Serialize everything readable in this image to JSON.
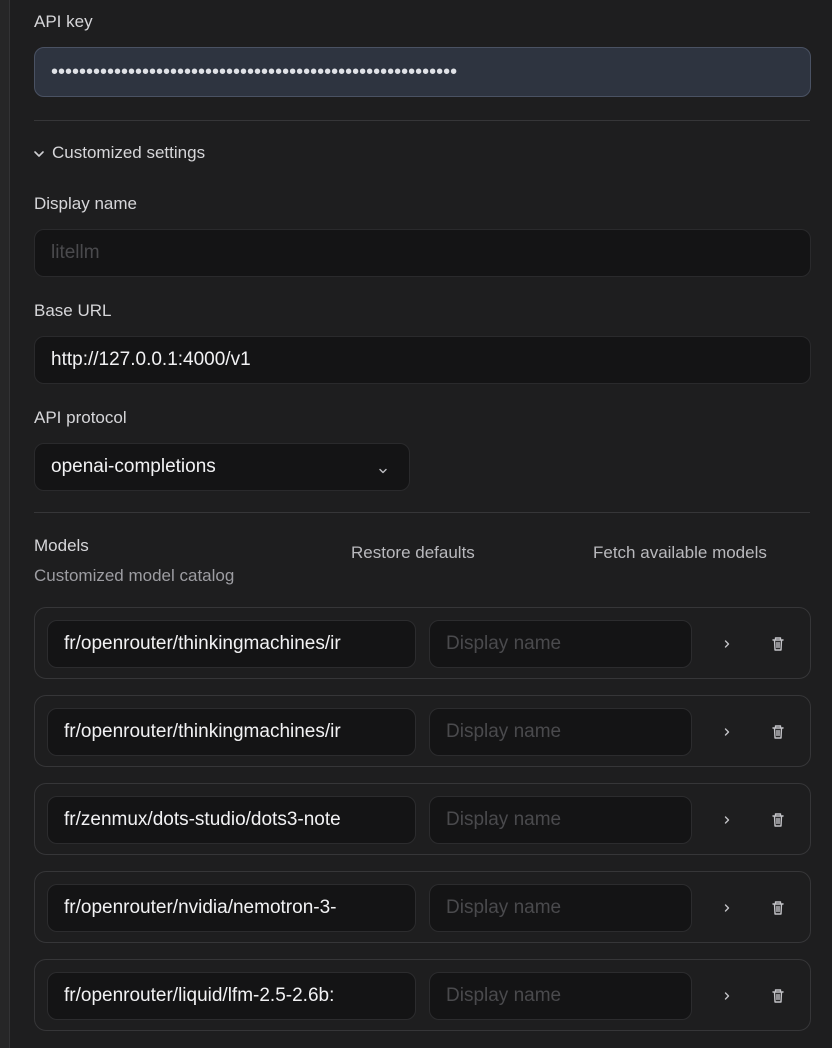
{
  "api_key": {
    "label": "API key",
    "masked_value": "••••••••••••••••••••••••••••••••••••••••••••••••••••••••••"
  },
  "customized_settings": {
    "toggle_label": "Customized settings",
    "expanded": true,
    "display_name": {
      "label": "Display name",
      "placeholder": "litellm",
      "value": ""
    },
    "base_url": {
      "label": "Base URL",
      "value": "http://127.0.0.1:4000/v1"
    },
    "api_protocol": {
      "label": "API protocol",
      "selected": "openai-completions"
    }
  },
  "models": {
    "title": "Models",
    "subtitle": "Customized model catalog",
    "restore_label": "Restore defaults",
    "fetch_label": "Fetch available models",
    "display_name_placeholder": "Display name",
    "items": [
      {
        "id": "fr/openrouter/thinkingmachines/ir",
        "display_name": ""
      },
      {
        "id": "fr/openrouter/thinkingmachines/ir",
        "display_name": ""
      },
      {
        "id": "fr/zenmux/dots-studio/dots3-note",
        "display_name": ""
      },
      {
        "id": "fr/openrouter/nvidia/nemotron-3-",
        "display_name": ""
      },
      {
        "id": "fr/openrouter/liquid/lfm-2.5-2.6b:",
        "display_name": ""
      }
    ]
  },
  "colors": {
    "background": "#1e1e1f",
    "input_bg": "#141415",
    "focused_input_bg": "#2e3440",
    "text": "#f2f2f4",
    "muted": "#9d9da2",
    "placeholder": "#4a4a4d"
  },
  "icons": {
    "section_toggle": "chevron-down-icon",
    "select_caret": "chevron-down-icon",
    "row_expand": "chevron-right-icon",
    "row_delete": "trash-icon"
  }
}
